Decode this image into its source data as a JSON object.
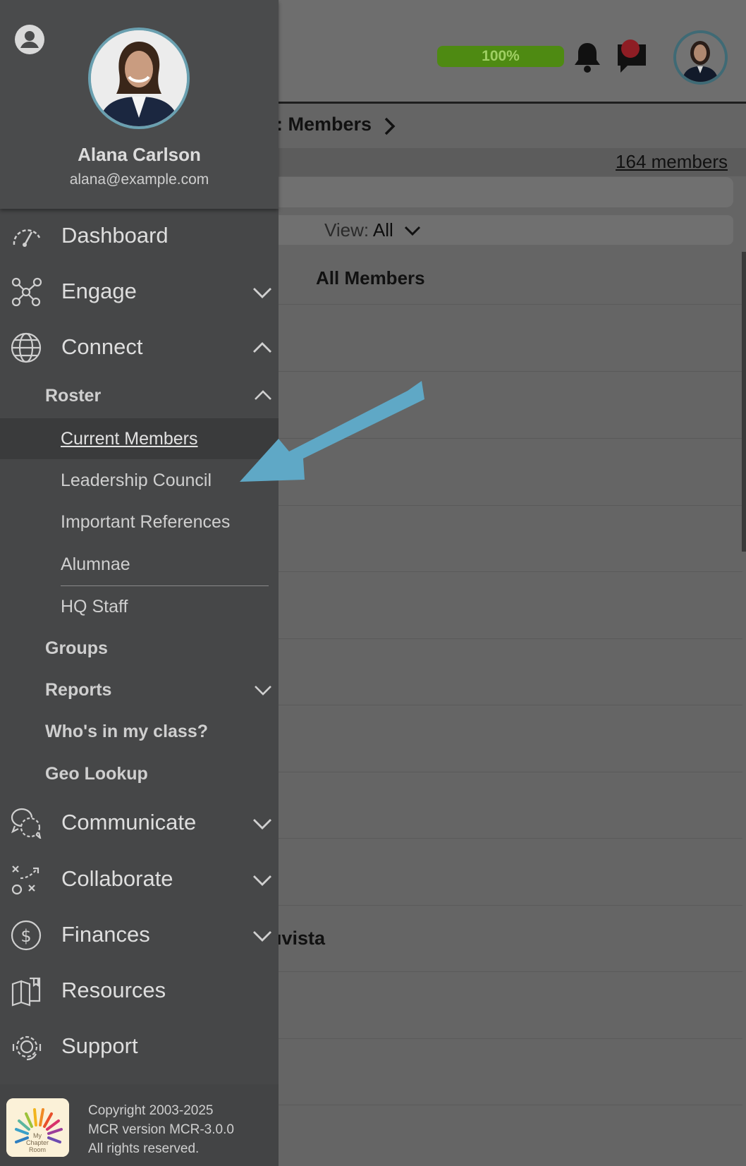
{
  "header": {
    "progress_label": "100%",
    "breadcrumb": ": Members",
    "member_count": "164 members"
  },
  "view": {
    "label": "View:",
    "value": "All"
  },
  "list": {
    "title": "All Members",
    "partial_row_text": "ıvista"
  },
  "drawer": {
    "user": {
      "name": "Alana Carlson",
      "email": "alana@example.com"
    },
    "nav": {
      "dashboard": "Dashboard",
      "engage": "Engage",
      "connect": "Connect",
      "communicate": "Communicate",
      "collaborate": "Collaborate",
      "finances": "Finances",
      "resources": "Resources",
      "support": "Support"
    },
    "connect_sub": {
      "roster": "Roster",
      "groups": "Groups",
      "reports": "Reports",
      "whos_in_my_class": "Who's in my class?",
      "geo_lookup": "Geo Lookup"
    },
    "roster_items": {
      "current_members": "Current Members",
      "leadership_council": "Leadership Council",
      "important_references": "Important References",
      "alumnae": "Alumnae",
      "hq_staff": "HQ Staff"
    },
    "footer": {
      "logo_text": "My Chapter Room",
      "copyright": "Copyright 2003-2025",
      "version": "MCR version MCR-3.0.0",
      "rights": "All rights reserved."
    }
  },
  "colors": {
    "drawer_bg": "#464748",
    "progress_green": "#4e8a12",
    "arrow": "#5fa8c6",
    "avatar_ring": "#6aa0b0",
    "notification_dot": "#8e1d24"
  }
}
